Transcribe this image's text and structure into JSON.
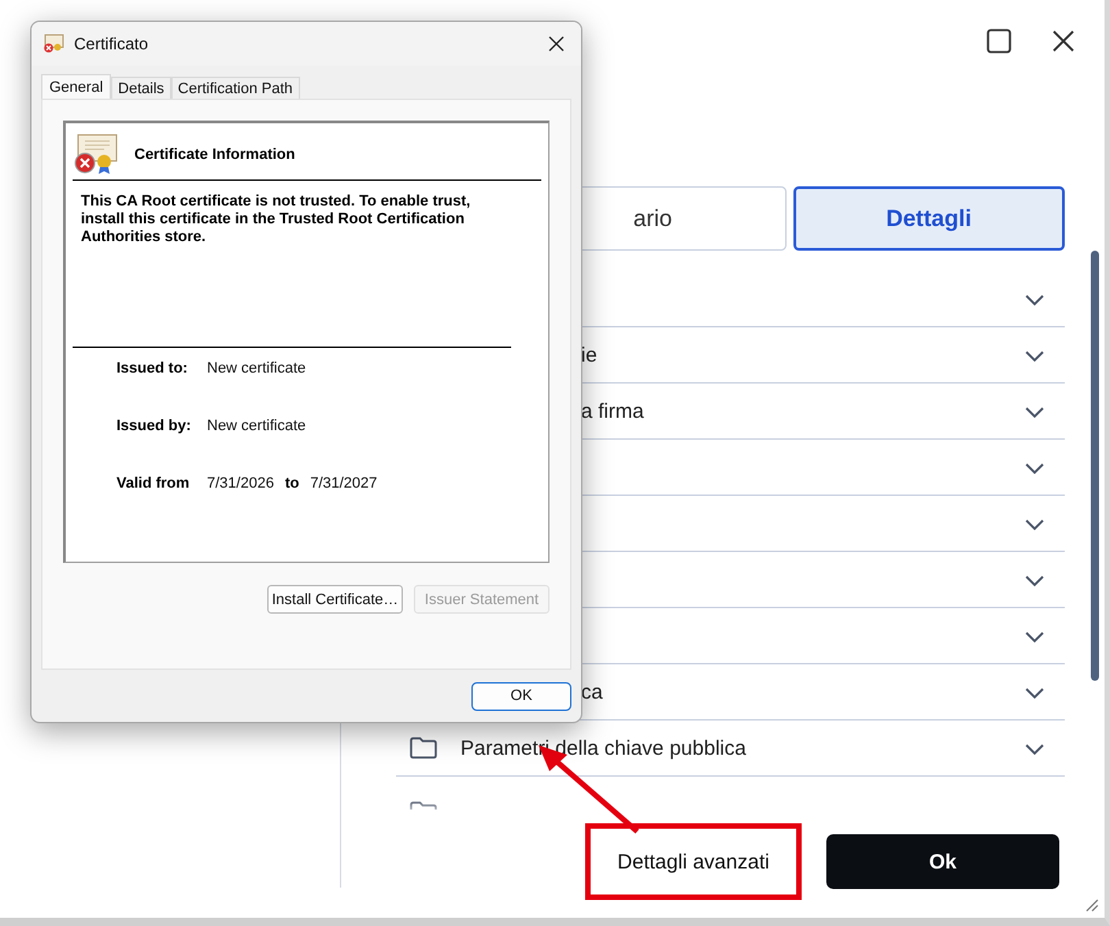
{
  "app_window": {
    "tabs": [
      {
        "label": "ario",
        "selected": false
      },
      {
        "label": "Dettagli",
        "selected": true
      }
    ],
    "sections": [
      {
        "kind": "covered"
      },
      {
        "kind": "covered",
        "label": "ie"
      },
      {
        "kind": "covered",
        "label": "a firma"
      },
      {
        "kind": "covered"
      },
      {
        "kind": "covered"
      },
      {
        "kind": "covered"
      },
      {
        "kind": "covered"
      },
      {
        "kind": "covered",
        "label": "ca"
      },
      {
        "kind": "folder",
        "label": "Parametri della chiave pubblica"
      },
      {
        "kind": "clipped"
      }
    ],
    "buttons": [
      {
        "label": "Dettagli avanzati",
        "kind": "secondary",
        "highlighted": true
      },
      {
        "label": "Ok",
        "kind": "primary",
        "highlighted": false
      }
    ]
  },
  "dialog": {
    "title": "Certificato",
    "tabs": [
      {
        "label": "General",
        "selected": true
      },
      {
        "label": "Details",
        "selected": false
      },
      {
        "label": "Certification Path",
        "selected": false
      }
    ],
    "heading": "Certificate Information",
    "message": "This CA Root certificate is not trusted. To enable trust, install this certificate in the Trusted Root Certification Authorities store.",
    "fields": [
      {
        "label": "Issued to:",
        "value": "New certificate"
      },
      {
        "label": "Issued by:",
        "value": "New certificate"
      }
    ],
    "validity": {
      "label": "Valid from",
      "from": "7/31/2026",
      "to_label": "to",
      "to": "7/31/2027"
    },
    "buttons": [
      {
        "label": "Install Certificate…",
        "disabled": false
      },
      {
        "label": "Issuer Statement",
        "disabled": true
      }
    ],
    "ok": "OK"
  }
}
